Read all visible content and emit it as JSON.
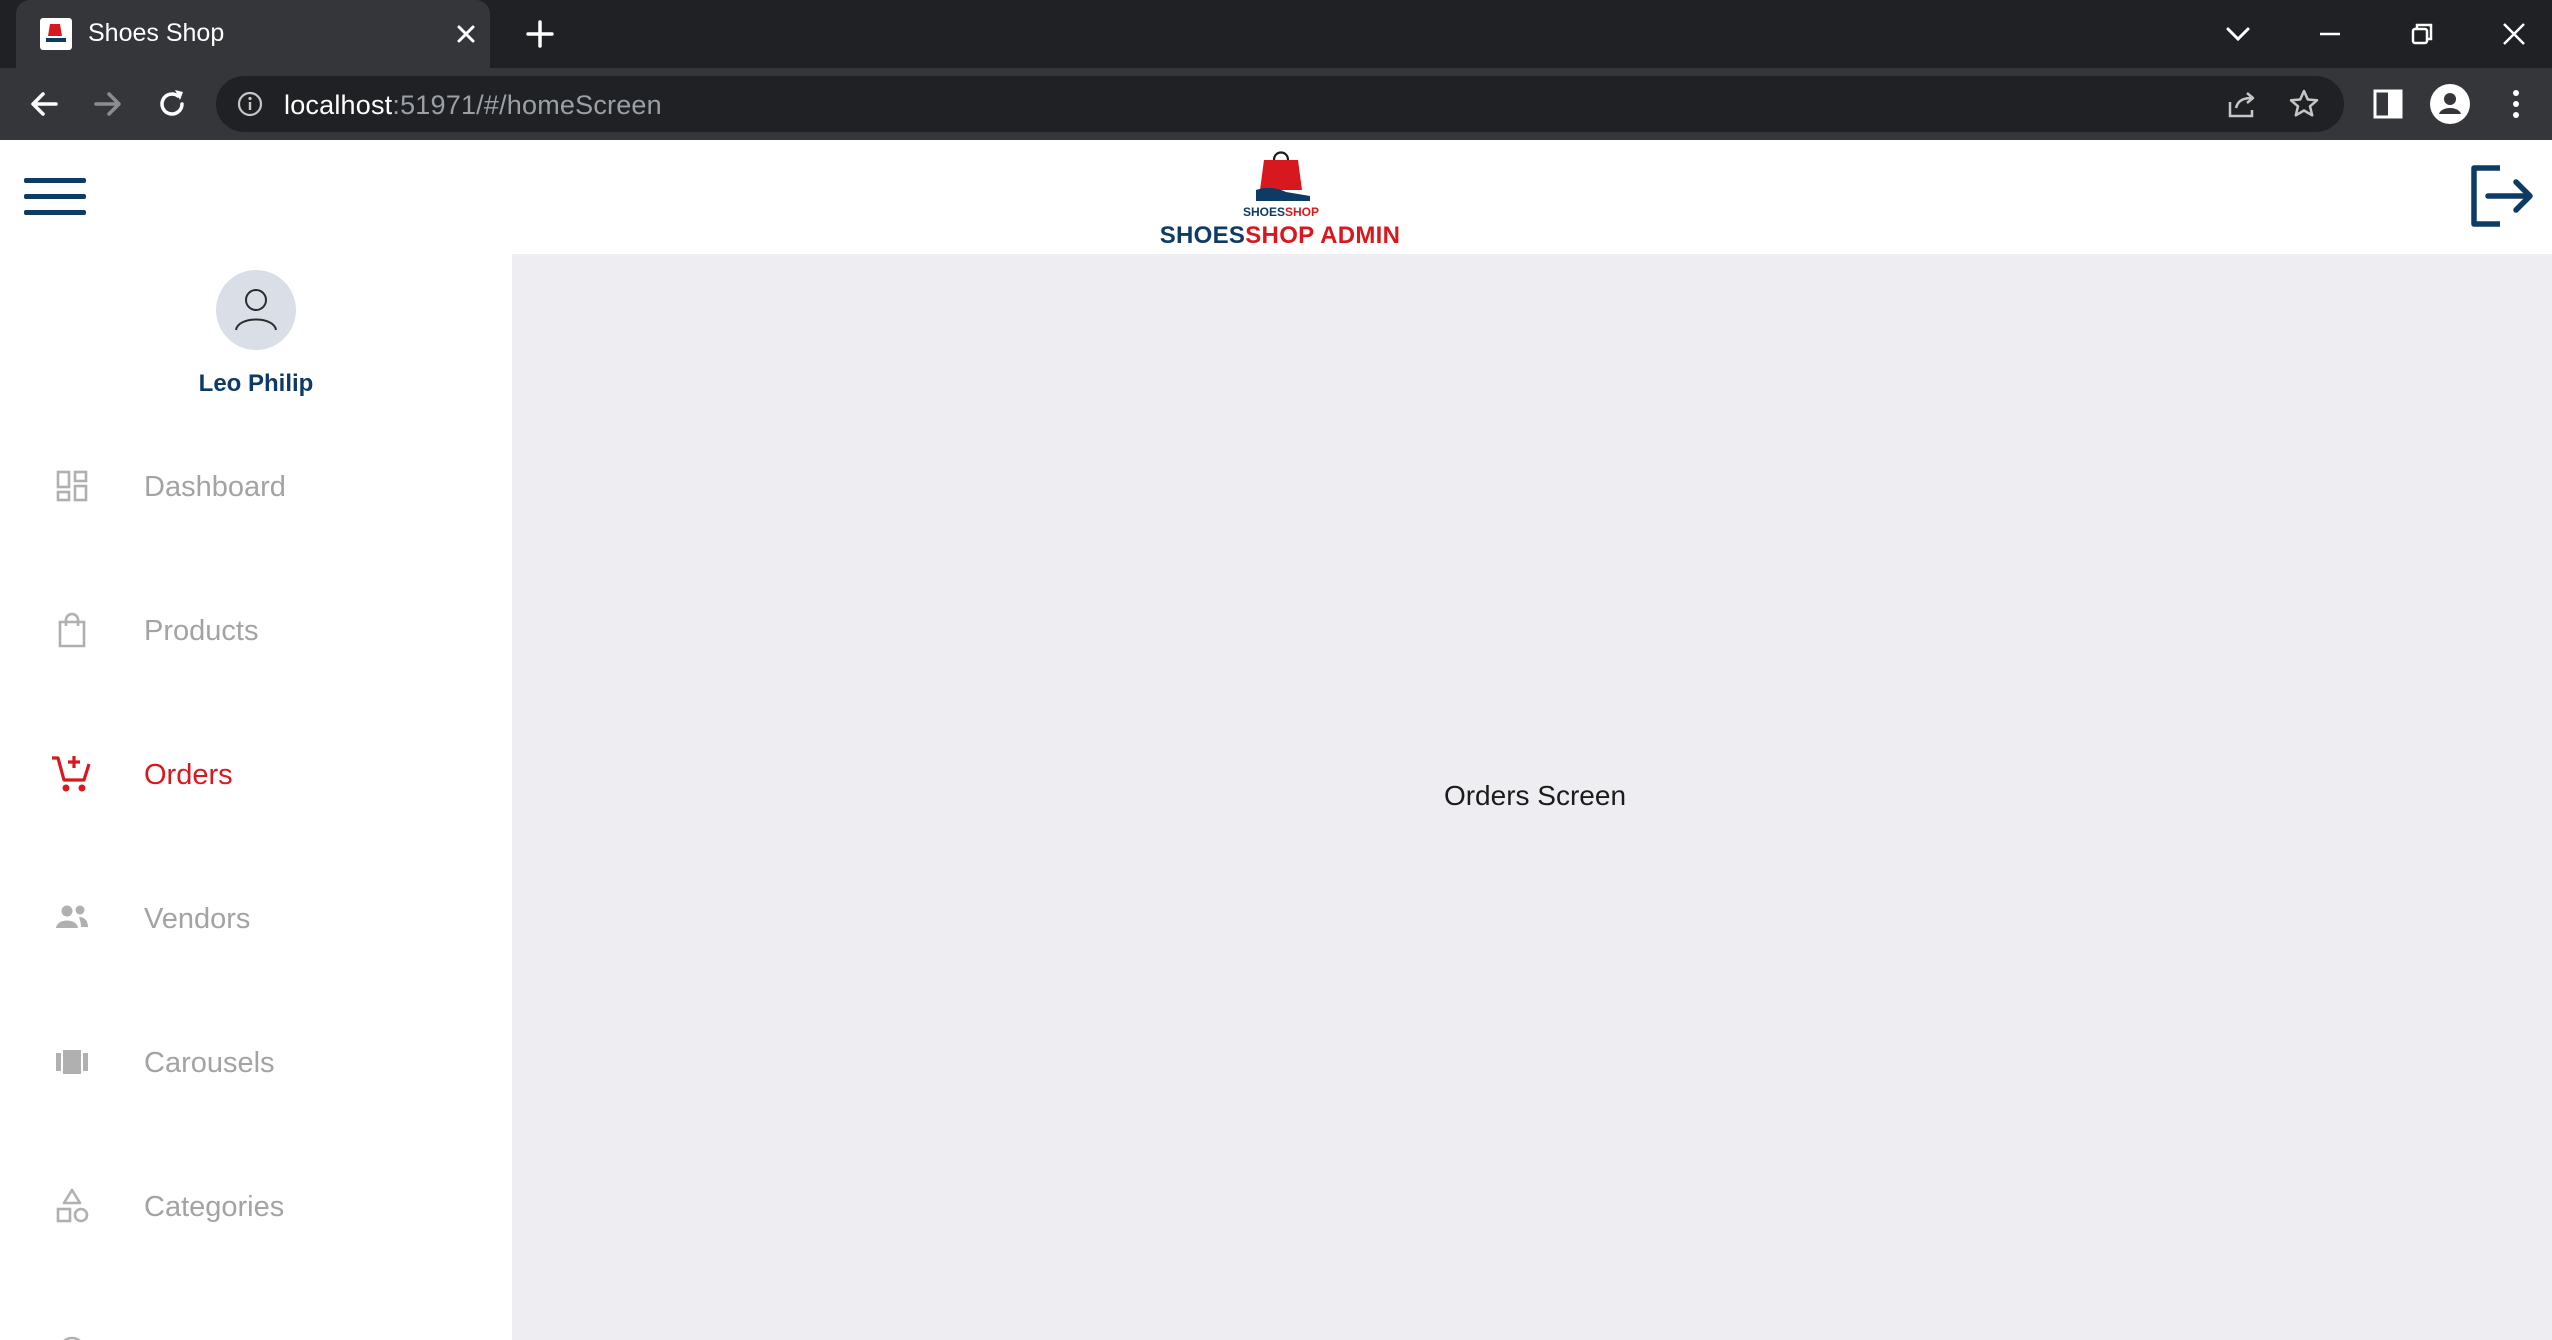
{
  "browser": {
    "tab_title": "Shoes Shop",
    "url_host": "localhost",
    "url_path": ":51971/#/homeScreen"
  },
  "header": {
    "logo_text": "SHOESSHOP",
    "brand_part1": "SHOES",
    "brand_part2": "SHOP ADMIN"
  },
  "sidebar": {
    "user_name": "Leo Philip",
    "items": [
      {
        "label": "Dashboard",
        "icon": "dashboard-icon",
        "active": false
      },
      {
        "label": "Products",
        "icon": "shopping-bag-icon",
        "active": false
      },
      {
        "label": "Orders",
        "icon": "cart-add-icon",
        "active": true
      },
      {
        "label": "Vendors",
        "icon": "people-icon",
        "active": false
      },
      {
        "label": "Carousels",
        "icon": "carousel-icon",
        "active": false
      },
      {
        "label": "Categories",
        "icon": "category-icon",
        "active": false
      }
    ]
  },
  "main": {
    "text": "Orders Screen"
  },
  "colors": {
    "brand_blue": "#0d3b66",
    "brand_red": "#d7191f",
    "inactive_text": "#a3a3a3",
    "content_bg": "#eeedf1"
  }
}
